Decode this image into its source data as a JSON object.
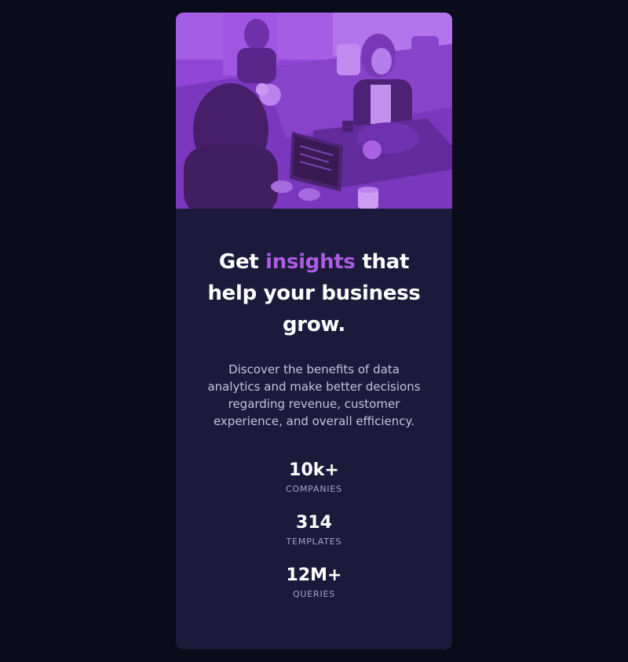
{
  "hero": {
    "image": "people-working-office-image",
    "overlay_color": "#aa5cdb"
  },
  "headline": {
    "before": "Get ",
    "accent": "insights",
    "after": " that help your business grow."
  },
  "description": "Discover the benefits of data analytics and make better decisions regarding revenue, customer experience, and overall efficiency.",
  "stats": [
    {
      "value": "10k+",
      "label": "COMPANIES"
    },
    {
      "value": "314",
      "label": "TEMPLATES"
    },
    {
      "value": "12M+",
      "label": "QUERIES"
    }
  ],
  "colors": {
    "page_bg": "#0a0c19",
    "card_bg": "#1c1a3b",
    "accent": "#ab5ce1",
    "heading": "#ffffff",
    "body_text": "#c5c3da"
  }
}
